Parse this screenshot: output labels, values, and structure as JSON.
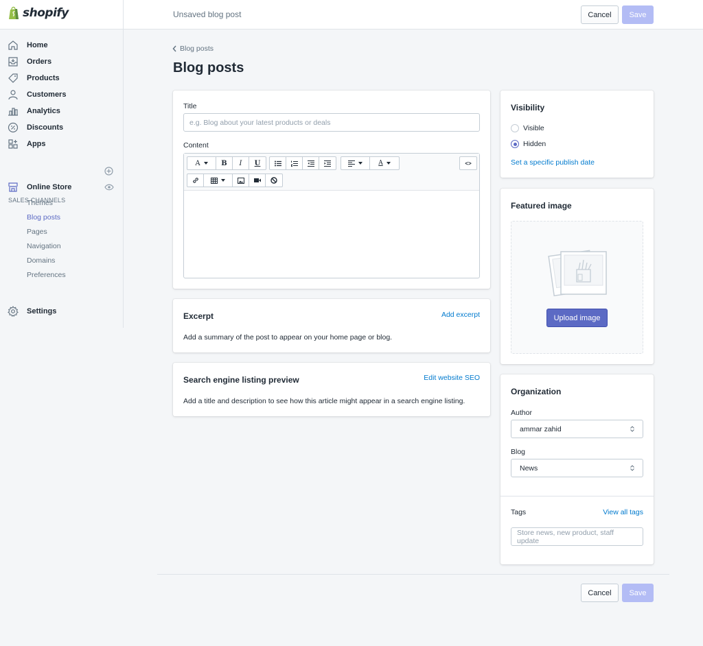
{
  "brand": {
    "name": "shopify"
  },
  "header": {
    "title": "Unsaved blog post",
    "cancel_label": "Cancel",
    "save_label": "Save"
  },
  "sidebar": {
    "items": [
      {
        "label": "Home",
        "icon": "home-icon"
      },
      {
        "label": "Orders",
        "icon": "orders-icon"
      },
      {
        "label": "Products",
        "icon": "tag-icon"
      },
      {
        "label": "Customers",
        "icon": "person-icon"
      },
      {
        "label": "Analytics",
        "icon": "analytics-icon"
      },
      {
        "label": "Discounts",
        "icon": "discount-icon"
      },
      {
        "label": "Apps",
        "icon": "apps-icon"
      }
    ],
    "sales_channels_label": "SALES CHANNELS",
    "online_store": {
      "label": "Online Store"
    },
    "sub_items": [
      "Themes",
      "Blog posts",
      "Pages",
      "Navigation",
      "Domains",
      "Preferences"
    ],
    "active_sub_item": "Blog posts",
    "settings_label": "Settings"
  },
  "page": {
    "breadcrumb": "Blog posts",
    "title": "Blog posts"
  },
  "main_card": {
    "title_label": "Title",
    "title_placeholder": "e.g. Blog about your latest products or deals",
    "content_label": "Content",
    "toolbar": {
      "font": "A",
      "bold": "B",
      "italic": "I",
      "underline": "U",
      "color": "A",
      "html": "<>"
    }
  },
  "excerpt": {
    "heading": "Excerpt",
    "link": "Add excerpt",
    "text": "Add a summary of the post to appear on your home page or blog."
  },
  "seo": {
    "heading": "Search engine listing preview",
    "link": "Edit website SEO",
    "text": "Add a title and description to see how this article might appear in a search engine listing."
  },
  "visibility": {
    "heading": "Visibility",
    "options": [
      "Visible",
      "Hidden"
    ],
    "selected": "Hidden",
    "link": "Set a specific publish date"
  },
  "featured_image": {
    "heading": "Featured image",
    "button": "Upload image"
  },
  "organization": {
    "heading": "Organization",
    "author_label": "Author",
    "author_value": "ammar zahid",
    "blog_label": "Blog",
    "blog_value": "News",
    "tags_label": "Tags",
    "tags_link": "View all tags",
    "tags_placeholder": "Store news, new product, staff update"
  },
  "footer": {
    "cancel_label": "Cancel",
    "save_label": "Save"
  },
  "colors": {
    "accent": "#5c6ac4",
    "link": "#007ace",
    "save_disabled": "#b3bcf5",
    "background": "#f4f6f8"
  }
}
